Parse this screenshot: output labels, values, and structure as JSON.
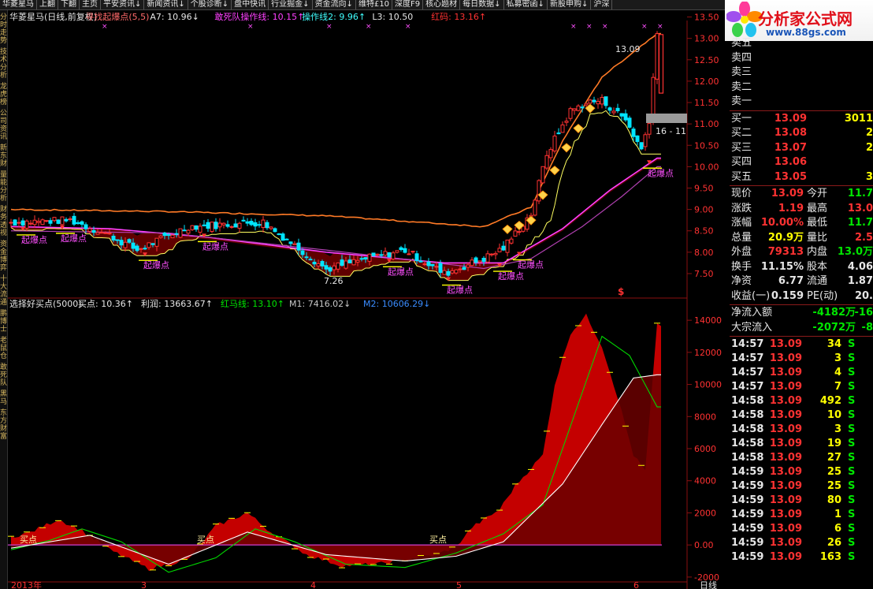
{
  "menu": [
    "华菱星马",
    "上翻",
    "下翻",
    "主页",
    "平安资讯↓",
    "新闻资讯↓",
    "个股诊断↓",
    "盘中快讯",
    "行业掘金↓",
    "资金流向↓",
    "维特£10",
    "深度F9",
    "核心题材",
    "每日数据↓",
    "私募密函↓",
    "新股申购↓",
    "沪深"
  ],
  "left_nav": [
    "分时走势",
    "技术分析",
    "龙虎榜",
    "公司资讯",
    "新东财",
    "量能分析",
    "财务透视",
    "资金博弈",
    "十大流通",
    "鹏博士",
    "老鼠仓",
    "敢死队",
    "黑马",
    "东方财富"
  ],
  "logo": {
    "name": "分析家公式网",
    "url": "www.88gs.com"
  },
  "colors": {
    "up": "#ff3232",
    "down": "#00e5ff",
    "ma_orange": "#ff7a26",
    "ma_magenta": "#ff40ff",
    "ma_purple": "#b040b0",
    "lower_fill": "#c40000",
    "m1": "#ffffff",
    "m2": "#00d800",
    "hot": "#ff50ff",
    "yellow": "#ffff00"
  },
  "price_header": [
    {
      "t": "华菱星马(日线,前复权)",
      "c": "#e6e6e6"
    },
    {
      "t": "寻找起爆点(5,5)",
      "c": "#ff6a6a"
    },
    {
      "t": "A7: 10.96↓",
      "c": "#e6e6e6"
    },
    {
      "t": "敢死队操作线: 10.15↑",
      "c": "#ff40ff"
    },
    {
      "t": "操作线2: 9.96↑",
      "c": "#40ffff"
    },
    {
      "t": "L3: 10.50",
      "c": "#e6e6e6"
    },
    {
      "t": "红码: 13.16↑",
      "c": "#ff3232"
    }
  ],
  "ind_header": [
    {
      "t": "选择好买点(5000)",
      "c": "#e6e6e6"
    },
    {
      "t": "买点: 10.36↑",
      "c": "#e6e6e6"
    },
    {
      "t": "利润: 13663.67↑",
      "c": "#e6e6e6"
    },
    {
      "t": "红马线: 13.10↑",
      "c": "#00e600"
    },
    {
      "t": "M1: 7416.02↓",
      "c": "#c8c8c8"
    },
    {
      "t": "M2: 10606.29↓",
      "c": "#3a8cff"
    }
  ],
  "annotations": {
    "burst": "起爆点",
    "buy": "买点",
    "high_label": "13.09",
    "low_label": "7.26",
    "right_label": "16 - 11",
    "dollar": "$",
    "cross": "×"
  },
  "order_book": {
    "sell": [
      {
        "label": "卖五",
        "price": "",
        "vol": ""
      },
      {
        "label": "卖四",
        "price": "",
        "vol": ""
      },
      {
        "label": "卖三",
        "price": "",
        "vol": ""
      },
      {
        "label": "卖二",
        "price": "",
        "vol": ""
      },
      {
        "label": "卖一",
        "price": "",
        "vol": ""
      }
    ],
    "buy": [
      {
        "label": "买一",
        "price": "13.09",
        "vol": "3011"
      },
      {
        "label": "买二",
        "price": "13.08",
        "vol": "2"
      },
      {
        "label": "买三",
        "price": "13.07",
        "vol": "2"
      },
      {
        "label": "买四",
        "price": "13.06",
        "vol": ""
      },
      {
        "label": "买五",
        "price": "13.05",
        "vol": "3"
      }
    ]
  },
  "quote": [
    {
      "l1": "现价",
      "v1": "13.09",
      "c1": "red",
      "l2": "今开",
      "v2": "11.7",
      "c2": "grn"
    },
    {
      "l1": "涨跌",
      "v1": "1.19",
      "c1": "red",
      "l2": "最高",
      "v2": "13.0",
      "c2": "red"
    },
    {
      "l1": "涨幅",
      "v1": "10.00%",
      "c1": "red",
      "l2": "最低",
      "v2": "11.7",
      "c2": "grn"
    },
    {
      "l1": "总量",
      "v1": "20.9万",
      "c1": "yel",
      "l2": "量比",
      "v2": "2.5",
      "c2": "red"
    },
    {
      "l1": "外盘",
      "v1": "79313",
      "c1": "red",
      "l2": "内盘",
      "v2": "13.0万",
      "c2": "grn"
    },
    {
      "l1": "换手",
      "v1": "11.15%",
      "c1": "wht",
      "l2": "股本",
      "v2": "4.06",
      "c2": "wht"
    },
    {
      "l1": "净资",
      "v1": "6.77",
      "c1": "wht",
      "l2": "流通",
      "v2": "1.87",
      "c2": "wht"
    },
    {
      "l1": "收益(一)",
      "v1": "0.159",
      "c1": "wht",
      "l2": "PE(动)",
      "v2": "20.",
      "c2": "wht"
    }
  ],
  "flows": [
    {
      "label": "净流入额",
      "value": "-4182万",
      "extra": "-16"
    },
    {
      "label": "大宗流入",
      "value": "-2072万",
      "extra": "-8"
    }
  ],
  "ticks": [
    {
      "time": "14:57",
      "price": "13.09",
      "vol": "34",
      "side": "S"
    },
    {
      "time": "14:57",
      "price": "13.09",
      "vol": "3",
      "side": "S"
    },
    {
      "time": "14:57",
      "price": "13.09",
      "vol": "4",
      "side": "S"
    },
    {
      "time": "14:57",
      "price": "13.09",
      "vol": "7",
      "side": "S"
    },
    {
      "time": "14:58",
      "price": "13.09",
      "vol": "492",
      "side": "S"
    },
    {
      "time": "14:58",
      "price": "13.09",
      "vol": "10",
      "side": "S"
    },
    {
      "time": "14:58",
      "price": "13.09",
      "vol": "3",
      "side": "S"
    },
    {
      "time": "14:58",
      "price": "13.09",
      "vol": "19",
      "side": "S"
    },
    {
      "time": "14:58",
      "price": "13.09",
      "vol": "27",
      "side": "S"
    },
    {
      "time": "14:59",
      "price": "13.09",
      "vol": "25",
      "side": "S"
    },
    {
      "time": "14:59",
      "price": "13.09",
      "vol": "25",
      "side": "S"
    },
    {
      "time": "14:59",
      "price": "13.09",
      "vol": "80",
      "side": "S"
    },
    {
      "time": "14:59",
      "price": "13.09",
      "vol": "1",
      "side": "S"
    },
    {
      "time": "14:59",
      "price": "13.09",
      "vol": "6",
      "side": "S"
    },
    {
      "time": "14:59",
      "price": "13.09",
      "vol": "26",
      "side": "S"
    },
    {
      "time": "14:59",
      "price": "13.09",
      "vol": "163",
      "side": "S"
    }
  ],
  "chart_data": [
    {
      "type": "candlestick",
      "title": "华菱星马(日线,前复权)",
      "ylim": [
        7.26,
        13.16
      ],
      "y_ticks": [
        7.5,
        8.0,
        8.5,
        9.0,
        9.5,
        10.0,
        10.5,
        11.0,
        11.5,
        12.0,
        12.5,
        13.0,
        13.5
      ],
      "x_labels": [
        {
          "i": 0,
          "t": "2013年"
        },
        {
          "i": 33,
          "t": "3"
        },
        {
          "i": 76,
          "t": "4"
        },
        {
          "i": 113,
          "t": "5"
        },
        {
          "i": 158,
          "t": "6"
        }
      ],
      "period_label": "日线",
      "price_anchors": [
        [
          0,
          8.7
        ],
        [
          15,
          8.75
        ],
        [
          25,
          8.4
        ],
        [
          32,
          8.05
        ],
        [
          45,
          8.6
        ],
        [
          64,
          8.7
        ],
        [
          70,
          8.3
        ],
        [
          80,
          7.6
        ],
        [
          90,
          7.85
        ],
        [
          100,
          8.05
        ],
        [
          110,
          7.5
        ],
        [
          120,
          7.85
        ],
        [
          125,
          8.1
        ],
        [
          132,
          8.9
        ],
        [
          136,
          10.3
        ],
        [
          142,
          11.3
        ],
        [
          146,
          11.5
        ],
        [
          150,
          11.55
        ],
        [
          156,
          11.1
        ],
        [
          160,
          10.4
        ],
        [
          162,
          11.1
        ],
        [
          164,
          13.09
        ]
      ],
      "band_upper_anchors": [
        [
          0,
          9.0
        ],
        [
          40,
          8.95
        ],
        [
          80,
          8.85
        ],
        [
          120,
          8.6
        ],
        [
          132,
          9.05
        ],
        [
          140,
          10.6
        ],
        [
          150,
          12.1
        ],
        [
          164,
          13.12
        ]
      ],
      "ma1_anchors": [
        [
          0,
          8.6
        ],
        [
          25,
          8.55
        ],
        [
          50,
          8.35
        ],
        [
          80,
          8.0
        ],
        [
          110,
          7.75
        ],
        [
          125,
          7.75
        ],
        [
          140,
          8.55
        ],
        [
          152,
          9.45
        ],
        [
          164,
          10.2
        ]
      ],
      "ma2_anchors": [
        [
          0,
          8.5
        ],
        [
          40,
          8.45
        ],
        [
          80,
          8.05
        ],
        [
          120,
          7.62
        ],
        [
          132,
          7.85
        ],
        [
          145,
          8.6
        ],
        [
          155,
          9.3
        ],
        [
          164,
          10.0
        ]
      ],
      "burst_markers": [
        3,
        13,
        34,
        49,
        96,
        111,
        124,
        129,
        162
      ],
      "diamond_range": [
        126,
        147
      ],
      "ma_labels": [
        {
          "i": 155,
          "v": "13.09"
        },
        {
          "i": 81,
          "v": "7.26"
        }
      ]
    },
    {
      "type": "area",
      "ylim": [
        -2400,
        14400
      ],
      "y_ticks": [
        -2000,
        0.0,
        2000,
        4000,
        6000,
        8000,
        10000,
        12000,
        14000
      ],
      "series": [
        {
          "name": "利润",
          "anchors": [
            [
              0,
              500
            ],
            [
              5,
              800
            ],
            [
              12,
              1600
            ],
            [
              18,
              900
            ],
            [
              25,
              -300
            ],
            [
              35,
              -1500
            ],
            [
              45,
              -900
            ],
            [
              52,
              1200
            ],
            [
              60,
              2000
            ],
            [
              66,
              800
            ],
            [
              75,
              -600
            ],
            [
              84,
              -1300
            ],
            [
              93,
              -1200
            ],
            [
              100,
              -900
            ],
            [
              108,
              -600
            ],
            [
              113,
              -100
            ],
            [
              117,
              1100
            ],
            [
              124,
              2200
            ],
            [
              128,
              3700
            ],
            [
              135,
              5600
            ],
            [
              138,
              10000
            ],
            [
              142,
              13200
            ],
            [
              146,
              14300
            ],
            [
              150,
              12400
            ],
            [
              154,
              9200
            ],
            [
              158,
              5600
            ],
            [
              161,
              4600
            ],
            [
              164,
              13700
            ]
          ]
        },
        {
          "name": "M1",
          "anchors": [
            [
              0,
              -300
            ],
            [
              10,
              300
            ],
            [
              18,
              1000
            ],
            [
              28,
              200
            ],
            [
              40,
              -1700
            ],
            [
              52,
              -800
            ],
            [
              62,
              1000
            ],
            [
              72,
              200
            ],
            [
              85,
              -1200
            ],
            [
              100,
              -1400
            ],
            [
              113,
              -500
            ],
            [
              125,
              700
            ],
            [
              135,
              2500
            ],
            [
              145,
              9500
            ],
            [
              150,
              13000
            ],
            [
              157,
              11800
            ],
            [
              164,
              8600
            ]
          ]
        },
        {
          "name": "M2",
          "anchors": [
            [
              0,
              -200
            ],
            [
              20,
              600
            ],
            [
              40,
              -1200
            ],
            [
              60,
              800
            ],
            [
              80,
              -600
            ],
            [
              100,
              -1000
            ],
            [
              113,
              -700
            ],
            [
              125,
              200
            ],
            [
              140,
              3800
            ],
            [
              150,
              7500
            ],
            [
              158,
              10400
            ],
            [
              164,
              10600
            ]
          ]
        }
      ],
      "buy_points": [
        3,
        48,
        107
      ],
      "buy_label": "买点"
    }
  ]
}
